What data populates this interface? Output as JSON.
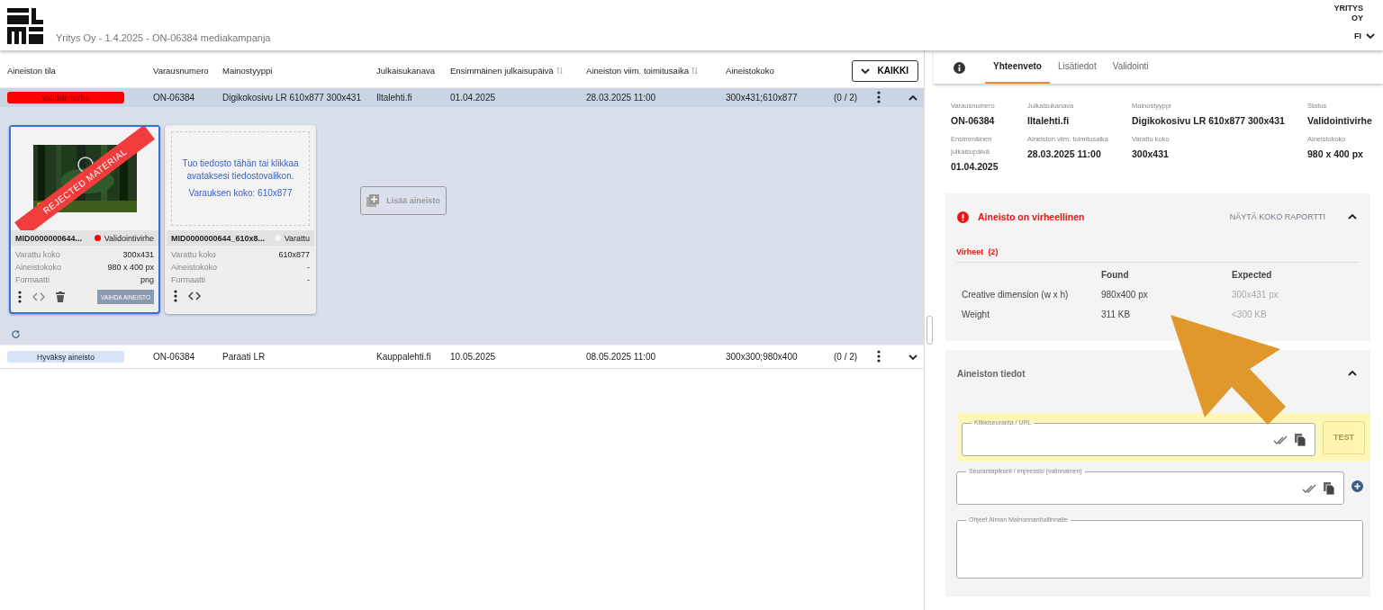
{
  "header": {
    "title": "Yritys Oy - 1.4.2025 - ON-06384 mediakampanja",
    "company": [
      "YRITYS",
      "OY"
    ],
    "language": "FI"
  },
  "table": {
    "columns": [
      {
        "label": "Aineiston tila",
        "sortable": false
      },
      {
        "label": "Varausnumero",
        "sortable": false
      },
      {
        "label": "Mainostyyppi",
        "sortable": false
      },
      {
        "label": "Julkaisukanava",
        "sortable": false
      },
      {
        "label": "Ensimmäinen julkaisupäivä",
        "sortable": true
      },
      {
        "label": "Aineiston viim. toimitusaika",
        "sortable": true
      },
      {
        "label": "Aineistokoko",
        "sortable": false
      }
    ],
    "filter_button": "KAIKKI",
    "rows": [
      {
        "color": "#ff0000",
        "kind": "error",
        "cells": [
          "Validointivirhe",
          "ON-06384",
          "Digikokosivu LR 610x877 300x431",
          "Iltalehti.fi",
          "01.04.2025",
          "28.03.2025 11:00",
          "300x431;610x877"
        ],
        "count": "(0 / 2)",
        "expanded": true,
        "selected": true,
        "materials": {
          "cards": [
            {
              "kind": "file",
              "selected": true,
              "ribbon": "REJECTED MATERIAL",
              "name": "MID0000000644...",
              "status": "Validointivirhe",
              "color": "#ff0000",
              "fields": [
                {
                  "label": "Varattu koko",
                  "value": "300x431"
                },
                {
                  "label": "Aineistokoko",
                  "value": "980 x 400 px"
                },
                {
                  "label": "Formaatti",
                  "value": "png"
                }
              ],
              "action": "VAIHDA AINEISTO"
            },
            {
              "kind": "dropzone",
              "selected": false,
              "drop_text": [
                "Tuo tiedosto tähän tai klikkaa avataksesi tiedostovalikon.",
                "Varauksen koko: 610x877"
              ],
              "name": "MID0000000644_610x8...",
              "status": "Varattu",
              "color": "#f4f4f4",
              "fields": [
                {
                  "label": "Varattu koko",
                  "value": "610x877"
                },
                {
                  "label": "Aineistokoko",
                  "value": "-"
                },
                {
                  "label": "Formaatti",
                  "value": "-"
                }
              ]
            }
          ],
          "add_button": "Lisää aineisto"
        }
      },
      {
        "color": "#d6e4f5",
        "kind": "pending",
        "cells": [
          "Hyväksy aineisto",
          "ON-06384",
          "Paraati LR",
          "Kauppalehti.fi",
          "10.05.2025",
          "08.05.2025 11:00",
          "300x300;980x400"
        ],
        "count": "(0 / 2)",
        "expanded": false,
        "selected": false
      }
    ]
  },
  "details": {
    "tabs": [
      {
        "label": "Yhteenveto",
        "selected": true
      },
      {
        "label": "Lisätiedot",
        "selected": false
      },
      {
        "label": "Validointi",
        "selected": false
      }
    ],
    "summary": [
      {
        "label": "Varausnumero",
        "value": "ON-06384"
      },
      {
        "label": "Julkaisukanava",
        "value": "Iltalehti.fi"
      },
      {
        "label": "Mainostyyppi",
        "value": "Digikokosivu LR 610x877 300x431"
      },
      {
        "label": "Status",
        "value": "Validointivirhe"
      },
      {
        "label": "Ensimmäinen julkaisupäivä",
        "value": "01.04.2025"
      },
      {
        "label": "Aineiston viim. toimitusaika",
        "value": "28.03.2025 11:00"
      },
      {
        "label": "Varattu koko",
        "value": "300x431"
      },
      {
        "label": "Aineistokoko",
        "value": "980 x 400 px"
      }
    ],
    "validation": {
      "title": "Aineisto on virheellinen",
      "report_link": "NÄYTÄ KOKO RAPORTTI",
      "expanded": true,
      "errors_label": "Virheet",
      "errors_count": "(2)",
      "columns": [
        "Found",
        "Expected"
      ],
      "rows": [
        {
          "name": "Creative dimension (w x h)",
          "found": "980x400 px",
          "expected": "300x431 px"
        },
        {
          "name": "Weight",
          "found": "311 KB",
          "expected": "<300 KB"
        }
      ]
    },
    "material_info": {
      "title": "Aineiston tiedot",
      "expanded": true,
      "fields": [
        {
          "kind": "url",
          "label": "Klikkiseuranta / URL",
          "highlighted": true,
          "button": "TEST"
        },
        {
          "kind": "pixel",
          "label": "Seurantapikseli / impressio (valinnainen)",
          "highlighted": false
        },
        {
          "kind": "textarea",
          "label": "Ohjeet Alman Mainonnanhallinnalle",
          "highlighted": false
        }
      ]
    }
  }
}
